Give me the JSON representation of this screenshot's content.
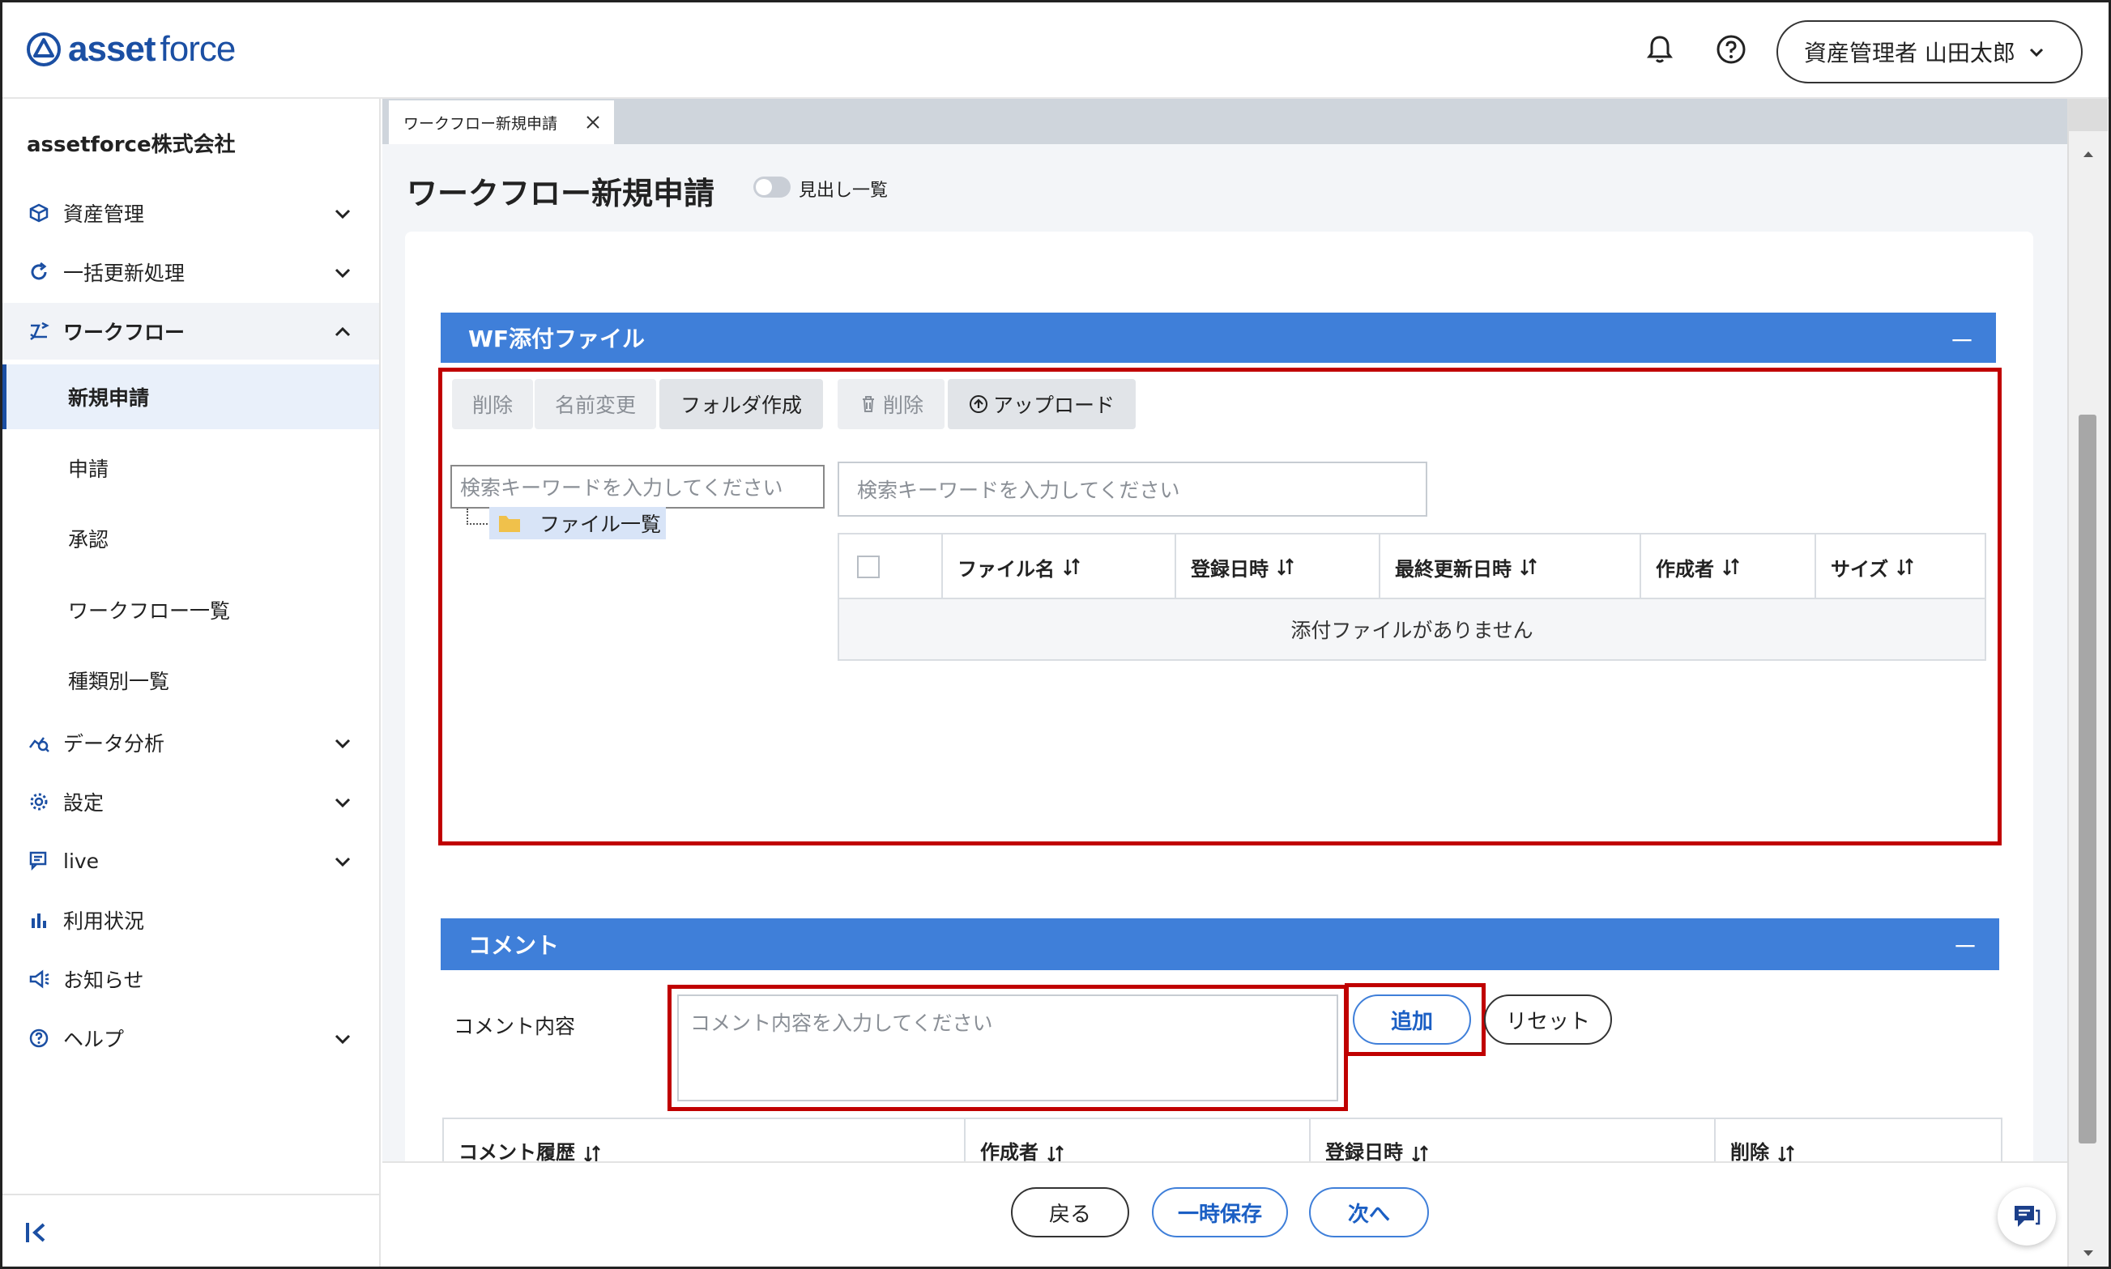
{
  "header": {
    "logo_bold": "asset",
    "logo_light": "force",
    "user_label": "資産管理者 山田太郎"
  },
  "sidebar": {
    "company": "assetforce株式会社",
    "items": [
      {
        "label": "資産管理",
        "icon": "cube-icon"
      },
      {
        "label": "一括更新処理",
        "icon": "refresh-icon"
      },
      {
        "label": "ワークフロー",
        "icon": "workflow-icon"
      },
      {
        "label": "データ分析",
        "icon": "analytics-icon"
      },
      {
        "label": "設定",
        "icon": "gear-icon"
      },
      {
        "label": "live",
        "icon": "live-chat-icon"
      },
      {
        "label": "利用状況",
        "icon": "bar-chart-icon"
      },
      {
        "label": "お知らせ",
        "icon": "megaphone-icon"
      },
      {
        "label": "ヘルプ",
        "icon": "help-circle-icon"
      }
    ],
    "workflow_subitems": [
      "新規申請",
      "申請",
      "承認",
      "ワークフロー一覧",
      "種類別一覧"
    ]
  },
  "tabs": [
    {
      "label": "ワークフロー新規申請"
    }
  ],
  "page": {
    "title": "ワークフロー新規申請",
    "toggle_label": "見出し一覧"
  },
  "attachments": {
    "section_title": "WF添付ファイル",
    "minimize": "－",
    "tree_toolbar": [
      "削除",
      "名前変更",
      "フォルダ作成"
    ],
    "file_toolbar": {
      "delete": "削除",
      "upload": "アップロード"
    },
    "tree_search_placeholder": "検索キーワードを入力してください",
    "file_search_placeholder": "検索キーワードを入力してください",
    "tree_root": "ファイル一覧",
    "columns": [
      "ファイル名",
      "登録日時",
      "最終更新日時",
      "作成者",
      "サイズ"
    ],
    "empty_message": "添付ファイルがありません"
  },
  "comment": {
    "section_title": "コメント",
    "minimize": "－",
    "field_label": "コメント内容",
    "placeholder": "コメント内容を入力してください",
    "add_label": "追加",
    "reset_label": "リセット",
    "history_columns": [
      "コメント履歴",
      "作成者",
      "登録日時",
      "削除"
    ]
  },
  "footer": {
    "back": "戻る",
    "save_draft": "一時保存",
    "next": "次へ"
  },
  "colors": {
    "accent": "#3f7fd9",
    "brand": "#1b4fa3",
    "highlight": "#c00000"
  }
}
